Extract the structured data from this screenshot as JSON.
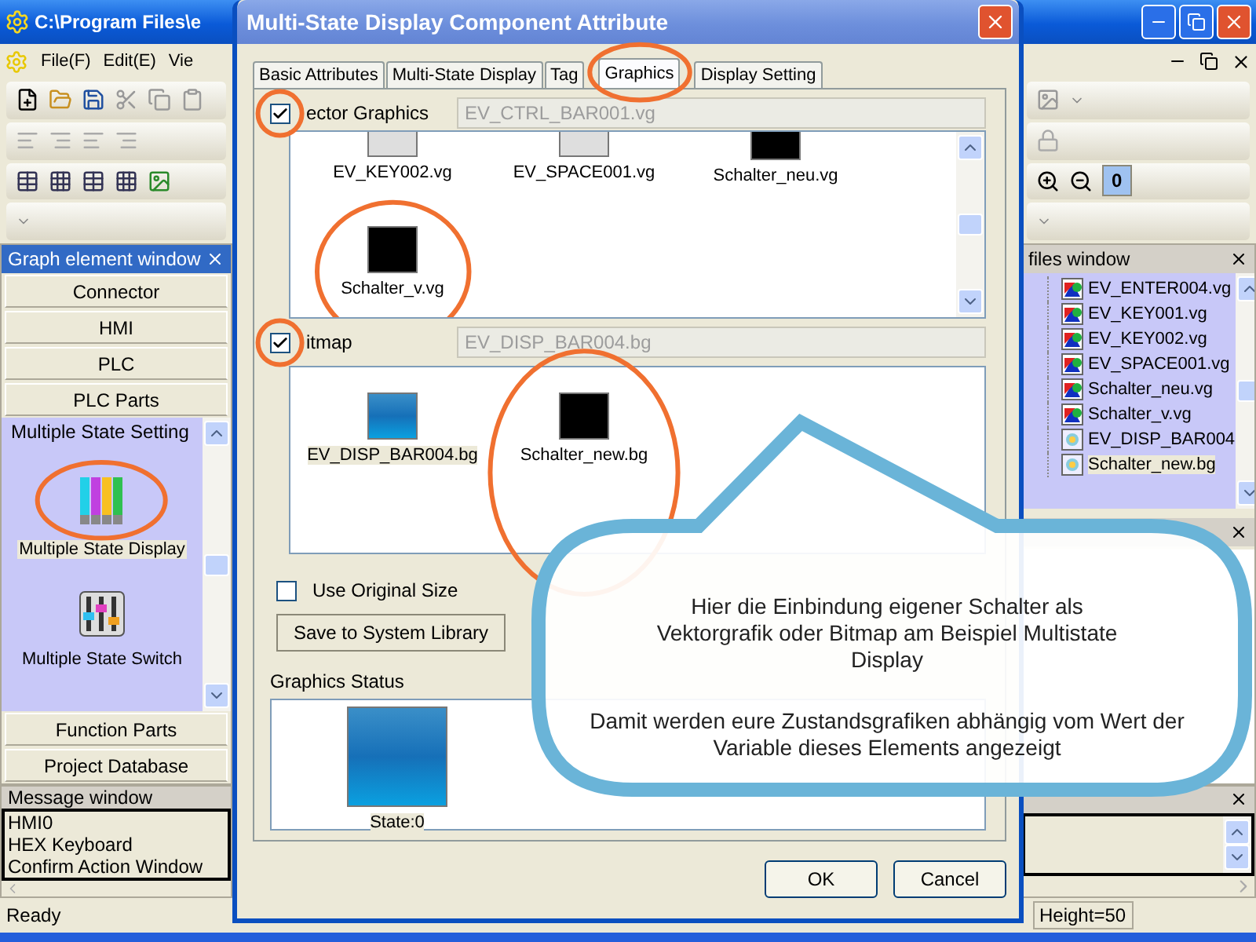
{
  "app": {
    "title": "C:\\Program Files\\e",
    "menu": [
      "File(F)",
      "Edit(E)",
      "Vie"
    ]
  },
  "left_panel": {
    "title": "Graph element window",
    "groups_top": [
      "Connector",
      "HMI",
      "PLC",
      "PLC Parts"
    ],
    "section": "Multiple State Setting",
    "items": [
      {
        "label": "Multiple State Display",
        "kind": "display",
        "selected": true,
        "circled": true
      },
      {
        "label": "Multiple State Switch",
        "kind": "switch",
        "selected": false,
        "circled": false
      }
    ],
    "groups_bottom": [
      "Function Parts",
      "Project Database"
    ]
  },
  "message_window": {
    "title": "Message window",
    "lines": [
      "HMI0",
      "HEX Keyboard",
      "Confirm Action Window"
    ]
  },
  "toolbar": {
    "zoom_value": "0"
  },
  "files_window": {
    "title": "files window",
    "items": [
      {
        "name": "EV_ENTER004.vg",
        "kind": "vector",
        "selected": false
      },
      {
        "name": "EV_KEY001.vg",
        "kind": "vector",
        "selected": false
      },
      {
        "name": "EV_KEY002.vg",
        "kind": "vector",
        "selected": false
      },
      {
        "name": "EV_SPACE001.vg",
        "kind": "vector",
        "selected": false
      },
      {
        "name": "Schalter_neu.vg",
        "kind": "vector",
        "selected": false
      },
      {
        "name": "Schalter_v.vg",
        "kind": "vector",
        "selected": false
      },
      {
        "name": "EV_DISP_BAR004",
        "kind": "bitmap",
        "selected": false
      },
      {
        "name": "Schalter_new.bg",
        "kind": "bitmap",
        "selected": true
      }
    ]
  },
  "status_bar": {
    "text": "Ready",
    "fields": [
      "Height=50"
    ]
  },
  "dialog": {
    "title": "Multi-State Display Component Attribute",
    "tabs": [
      {
        "label": "Basic Attributes",
        "selected": false
      },
      {
        "label": "Multi-State Display",
        "selected": false
      },
      {
        "label": "Tag",
        "selected": false
      },
      {
        "label": "Graphics",
        "selected": true
      },
      {
        "label": "Display Setting",
        "selected": false
      }
    ],
    "vector": {
      "label": "ector Graphics",
      "checked": true,
      "circled": true,
      "file": "EV_CTRL_BAR001.vg",
      "items": [
        {
          "name": "EV_KEY002.vg",
          "kind": "gray",
          "selected": false,
          "circled": false
        },
        {
          "name": "EV_SPACE001.vg",
          "kind": "gray",
          "selected": false,
          "circled": false
        },
        {
          "name": "Schalter_neu.vg",
          "kind": "black",
          "selected": false,
          "circled": false
        },
        {
          "name": "Schalter_v.vg",
          "kind": "black",
          "selected": false,
          "circled": true
        }
      ]
    },
    "bitmap": {
      "label": "itmap",
      "checked": true,
      "circled": true,
      "file": "EV_DISP_BAR004.bg",
      "items": [
        {
          "name": "EV_DISP_BAR004.bg",
          "kind": "blue",
          "selected": true,
          "circled": false
        },
        {
          "name": "Schalter_new.bg",
          "kind": "black",
          "selected": false,
          "circled": true
        }
      ]
    },
    "use_original_size": {
      "label": "Use Original Size",
      "checked": false
    },
    "save_button": "Save to System Library",
    "status_title": "Graphics Status",
    "states": [
      {
        "label": "State:0",
        "kind": "blue"
      }
    ],
    "buttons": [
      "OK",
      "Cancel"
    ]
  },
  "callout": {
    "paragraphs": [
      "Hier die Einbindung eigener Schalter als Vektorgrafik oder Bitmap am Beispiel Multistate Display",
      "Damit werden eure Zustandsgrafiken abhängig vom Wert der Variable dieses Elements angezeigt"
    ]
  }
}
